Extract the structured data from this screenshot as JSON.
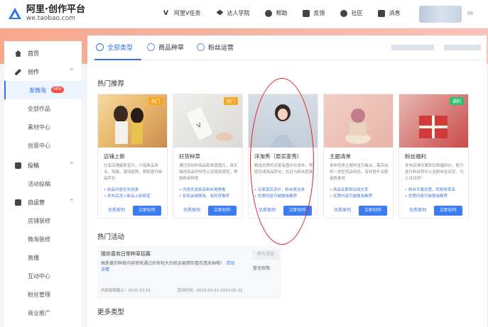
{
  "header": {
    "logo_line1": "阿里·创作平台",
    "logo_line2": "we.taobao.com",
    "nav": [
      {
        "label": "阿里V任务",
        "icon": "v-icon"
      },
      {
        "label": "达人学院",
        "icon": "graduation-icon"
      },
      {
        "label": "帮助",
        "icon": "help-icon"
      },
      {
        "label": "反馈",
        "icon": "feedback-icon"
      },
      {
        "label": "社区",
        "icon": "community-icon"
      },
      {
        "label": "消息",
        "icon": "mail-icon"
      }
    ]
  },
  "sidebar": {
    "items": [
      {
        "label": "首页",
        "icon": "home-icon",
        "type": "top"
      },
      {
        "label": "创作",
        "icon": "pen-icon",
        "type": "group"
      },
      {
        "label": "发微淘",
        "type": "sub",
        "active": true,
        "badge": "NEW"
      },
      {
        "label": "全部作品",
        "type": "sub"
      },
      {
        "label": "素材中心",
        "type": "sub"
      },
      {
        "label": "创意中心",
        "type": "sub"
      },
      {
        "label": "投稿",
        "icon": "submit-icon",
        "type": "group"
      },
      {
        "label": "活动投稿",
        "type": "sub"
      },
      {
        "label": "自运营",
        "icon": "operate-icon",
        "type": "group"
      },
      {
        "label": "店铺装修",
        "type": "sub"
      },
      {
        "label": "微淘装修",
        "type": "sub"
      },
      {
        "label": "直播",
        "type": "sub"
      },
      {
        "label": "互动中心",
        "type": "sub"
      },
      {
        "label": "粉丝管理",
        "type": "sub"
      },
      {
        "label": "商业推广",
        "type": "sub"
      }
    ]
  },
  "tabs": [
    {
      "label": "全部类型",
      "active": true
    },
    {
      "label": "商品种草",
      "active": false
    },
    {
      "label": "粉丝运营",
      "active": false
    }
  ],
  "sections": {
    "hot": "热门推荐",
    "activity": "热门活动",
    "more": "更多类型"
  },
  "cards": [
    {
      "tag": "热门",
      "tag_color": "#f5a623",
      "title": "店铺上新",
      "desc": "分享店铺最新宝贝，介绍新品卖点、风格、潮流趋势，帮助提升新品转化",
      "bullets": [
        "新品内容优先收录",
        "发布后进入新品上新频道"
      ],
      "example": "优质案例",
      "create": "立即创作"
    },
    {
      "tag": "热门",
      "tag_color": "#f5a623",
      "title": "好货种草",
      "desc": "通过实拍的商品和场景图片，真实描述商品的特色以及使用感受，帮助粉丝种草",
      "bullets": [
        "内容优选审高粉丝晃擦看",
        "有机会被微淘、有好货推荐"
      ],
      "example": "优质案例",
      "create": "立即创作"
    },
    {
      "tag": "",
      "tag_color": "",
      "title": "洋淘秀（原买家秀）",
      "desc": "精选优质的买家有图评价发布，帮助完成商品转化，拉近与粉丝距离",
      "bullets": [
        "买家真实评价，粉丝更买单",
        "优质内容可被微淘推荐"
      ],
      "example": "优质案例",
      "create": "立即创作"
    },
    {
      "tag": "",
      "tag_color": "",
      "title": "主题清单",
      "desc": "发布同类主题的宝贝集合，需突出同一类型货品特色，有利提升关联选购客效",
      "bullets": [
        "商品关联带动成交率",
        "优质内容可被微淘推荐"
      ],
      "example": "优质案例",
      "create": "立即创作"
    },
    {
      "tag": "福利",
      "tag_color": "#2fbf71",
      "title": "粉丝福利",
      "desc": "发布店铺专属折扣和福利价，助力提升粉丝转化以及粉丝在店优，马上试试吧！",
      "bullets": [
        "粉丝专属优惠，转粉效率高",
        "优质内容可被微淘推荐"
      ],
      "example": "优质案例",
      "create": "立即创作"
    }
  ],
  "activity": {
    "title": "猜你喜欢日常种草招募",
    "desc": "高质量的种草内容审核通过后有较大的机会被猜你喜欢透采纳哦！",
    "link": "活动详情",
    "submit_date": "内容投稿截止：2020.03.31",
    "activity_date": "活动时间：2020.04.01-2020.05.31",
    "button": "参与活动",
    "status": "暂无权限"
  },
  "colors": {
    "accent": "#2f6ff0",
    "banner": "#f6b1a0",
    "new_badge": "#ff4b3e"
  }
}
